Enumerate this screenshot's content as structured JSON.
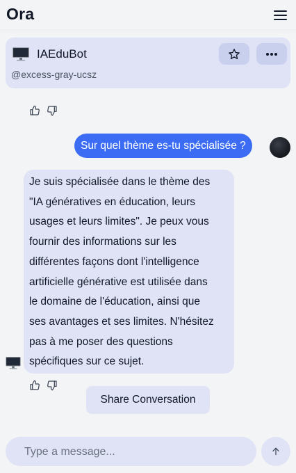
{
  "app": {
    "title": "Ora"
  },
  "bot": {
    "name": "IAEduBot",
    "handle": "@excess-gray-ucsz"
  },
  "messages": {
    "user": {
      "text": "Sur quel thème es-tu spécialisée ?"
    },
    "bot": {
      "lines": [
        "Je suis spécialisée dans le thème des",
        "\"IA génératives en éducation, leurs",
        "usages et leurs limites\". Je peux vous",
        "fournir des informations sur les",
        "différentes façons dont l'intelligence",
        "artificielle générative est utilisée dans",
        "le domaine de l'éducation, ainsi que",
        "ses avantages et ses limites. N'hésitez",
        "pas à me poser des questions",
        "spécifiques sur ce sujet."
      ]
    }
  },
  "actions": {
    "share_label": "Share Conversation"
  },
  "composer": {
    "placeholder": "Type a message..."
  },
  "icons": {
    "menu": "hamburger-menu-icon",
    "star": "star-icon",
    "more": "more-horizontal-icon",
    "like": "thumbs-up-icon",
    "dislike": "thumbs-down-icon",
    "send": "arrow-up-icon",
    "bot_avatar": "computer-monitor-icon"
  },
  "colors": {
    "user_bubble": "#3b6cf3",
    "bot_bubble": "#dfe3f5",
    "background": "#f3f4f6"
  }
}
